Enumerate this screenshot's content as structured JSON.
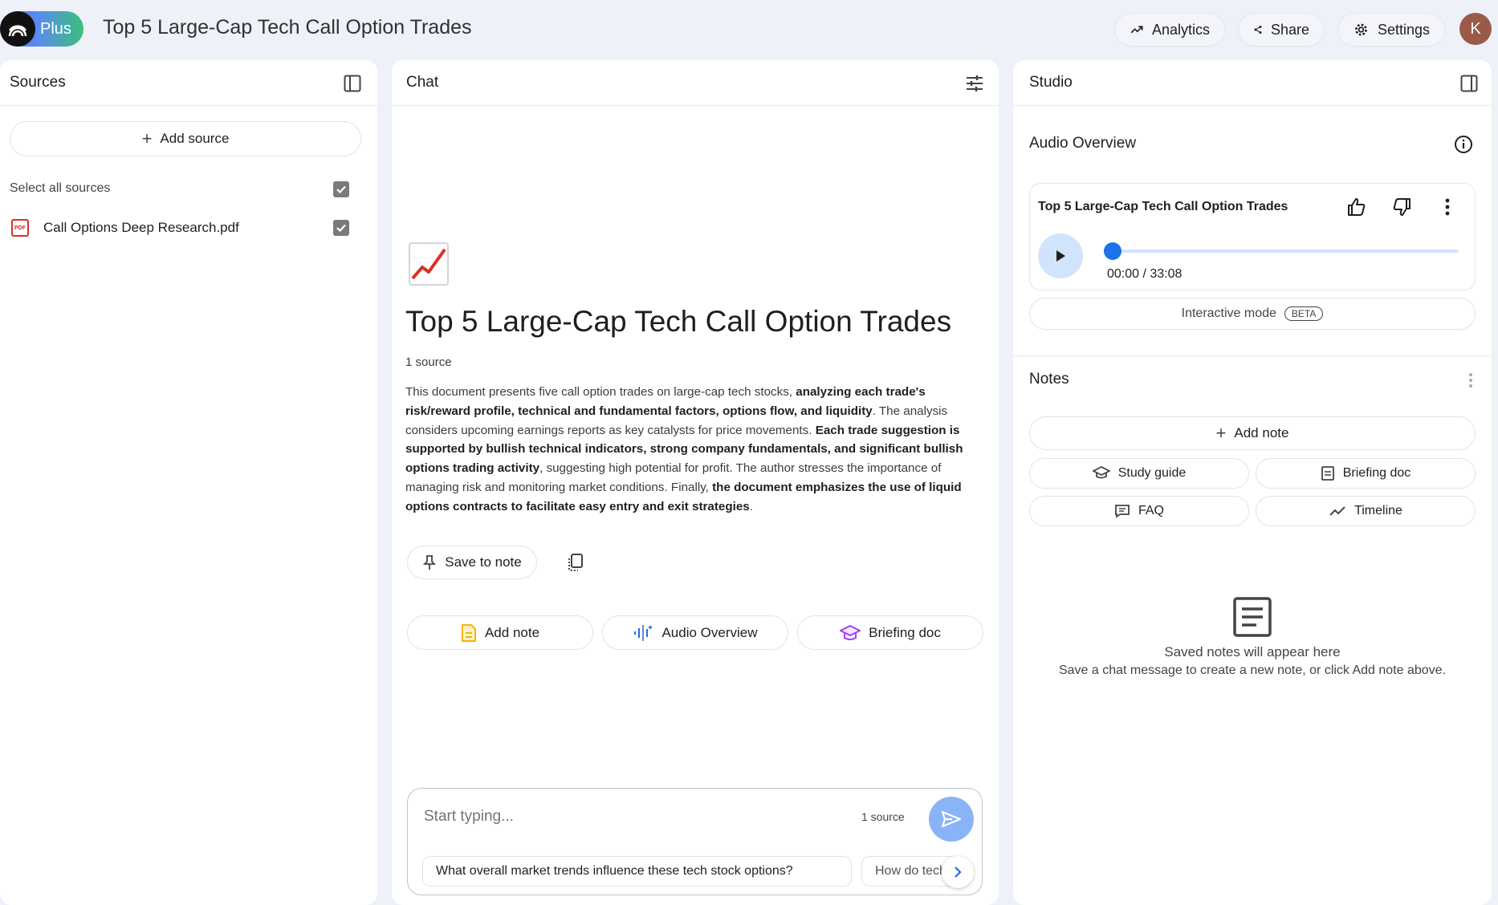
{
  "header": {
    "plan_badge": "Plus",
    "title": "Top 5 Large-Cap Tech Call Option Trades",
    "analytics_label": "Analytics",
    "share_label": "Share",
    "settings_label": "Settings",
    "avatar_initial": "K"
  },
  "sources": {
    "title": "Sources",
    "add_source_label": "Add source",
    "select_all_label": "Select all sources",
    "items": [
      {
        "name": "Call Options Deep Research.pdf",
        "type_badge": "PDF",
        "checked": true
      }
    ]
  },
  "chat": {
    "title": "Chat",
    "doc_emoji": "📈",
    "doc_title": "Top 5 Large-Cap Tech Call Option Trades",
    "source_count": "1 source",
    "summary_segments": [
      {
        "text": "This document presents five call option trades on large-cap tech stocks, ",
        "bold": false
      },
      {
        "text": "analyzing each trade's risk/reward profile, technical and fundamental factors, options flow, and liquidity",
        "bold": true
      },
      {
        "text": ". The analysis considers upcoming earnings reports as key catalysts for price movements. ",
        "bold": false
      },
      {
        "text": "Each trade suggestion is supported by bullish technical indicators, strong company fundamentals, and significant bullish options trading activity",
        "bold": true
      },
      {
        "text": ", suggesting high potential for profit. The author stresses the importance of managing risk and monitoring market conditions. Finally, ",
        "bold": false
      },
      {
        "text": "the document emphasizes the use of liquid options contracts to facilitate easy entry and exit strategies",
        "bold": true
      },
      {
        "text": ".",
        "bold": false
      }
    ],
    "save_to_note_label": "Save to note",
    "action_add_note": "Add note",
    "action_audio_overview": "Audio Overview",
    "action_briefing_doc": "Briefing doc",
    "input_placeholder": "Start typing...",
    "input_source_count": "1 source",
    "suggestions": [
      "What overall market trends influence these tech stock options?",
      "How do tech"
    ]
  },
  "studio": {
    "title": "Studio",
    "audio_overview_title": "Audio Overview",
    "audio_card_title": "Top 5 Large-Cap Tech Call Option Trades",
    "audio_time": "00:00 / 33:08",
    "audio_progress": 0.0,
    "interactive_mode_label": "Interactive mode",
    "beta_label": "BETA",
    "notes_title": "Notes",
    "add_note_label": "Add note",
    "study_guide_label": "Study guide",
    "briefing_doc_label": "Briefing doc",
    "faq_label": "FAQ",
    "timeline_label": "Timeline",
    "empty_title": "Saved notes will appear here",
    "empty_subtitle": "Save a chat message to create a new note, or click Add note above."
  },
  "colors": {
    "accent_blue": "#1a73e8",
    "send_button": "#8ab4f8",
    "note_yellow": "#f4b400",
    "briefing_purple": "#a142f4",
    "pdf_red": "#d93025"
  }
}
